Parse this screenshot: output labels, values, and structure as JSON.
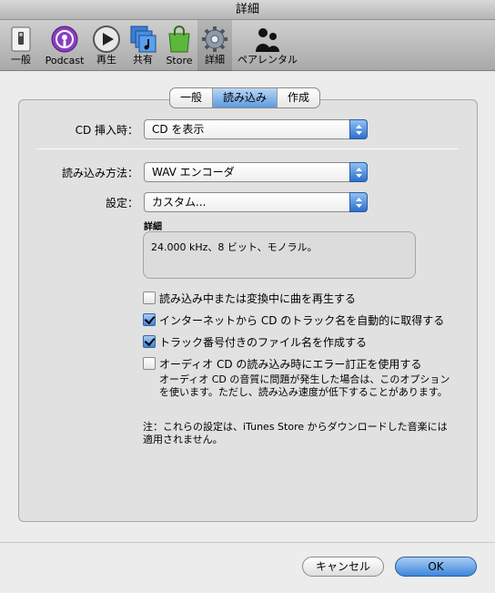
{
  "window": {
    "title": "詳細"
  },
  "toolbar": {
    "items": [
      {
        "label": "一般",
        "icon": "switch-icon"
      },
      {
        "label": "Podcast",
        "icon": "podcast-icon"
      },
      {
        "label": "再生",
        "icon": "play-icon"
      },
      {
        "label": "共有",
        "icon": "shared-music-icon"
      },
      {
        "label": "Store",
        "icon": "store-bag-icon"
      },
      {
        "label": "詳細",
        "icon": "gear-icon",
        "selected": true
      },
      {
        "label": "ペアレンタル",
        "icon": "parental-icon"
      }
    ]
  },
  "tabs": [
    {
      "label": "一般",
      "active": false
    },
    {
      "label": "読み込み",
      "active": true
    },
    {
      "label": "作成",
      "active": false
    }
  ],
  "cd_insert": {
    "label": "CD 挿入時：",
    "value": "CD を表示"
  },
  "import_method": {
    "label": "読み込み方法：",
    "value": "WAV エンコーダ"
  },
  "setting": {
    "label": "設定：",
    "value": "カスタム..."
  },
  "details": {
    "title": "詳細",
    "text": "24.000 kHz、8 ビット、モノラル。"
  },
  "checkboxes": [
    {
      "label": "読み込み中または変換中に曲を再生する",
      "checked": false
    },
    {
      "label": "インターネットから CD のトラック名を自動的に取得する",
      "checked": true
    },
    {
      "label": "トラック番号付きのファイル名を作成する",
      "checked": true
    },
    {
      "label": "オーディオ CD の読み込み時にエラー訂正を使用する",
      "checked": false
    }
  ],
  "error_correction_note": {
    "line1": "オーディオ CD の音質に問題が発生した場合は、このオプション",
    "line2": "を使います。ただし、読み込み速度が低下することがあります。"
  },
  "footer_note": {
    "line1": "注：これらの設定は、iTunes Store からダウンロードした音楽には",
    "line2": "適用されません。"
  },
  "buttons": {
    "cancel": "キャンセル",
    "ok": "OK"
  }
}
